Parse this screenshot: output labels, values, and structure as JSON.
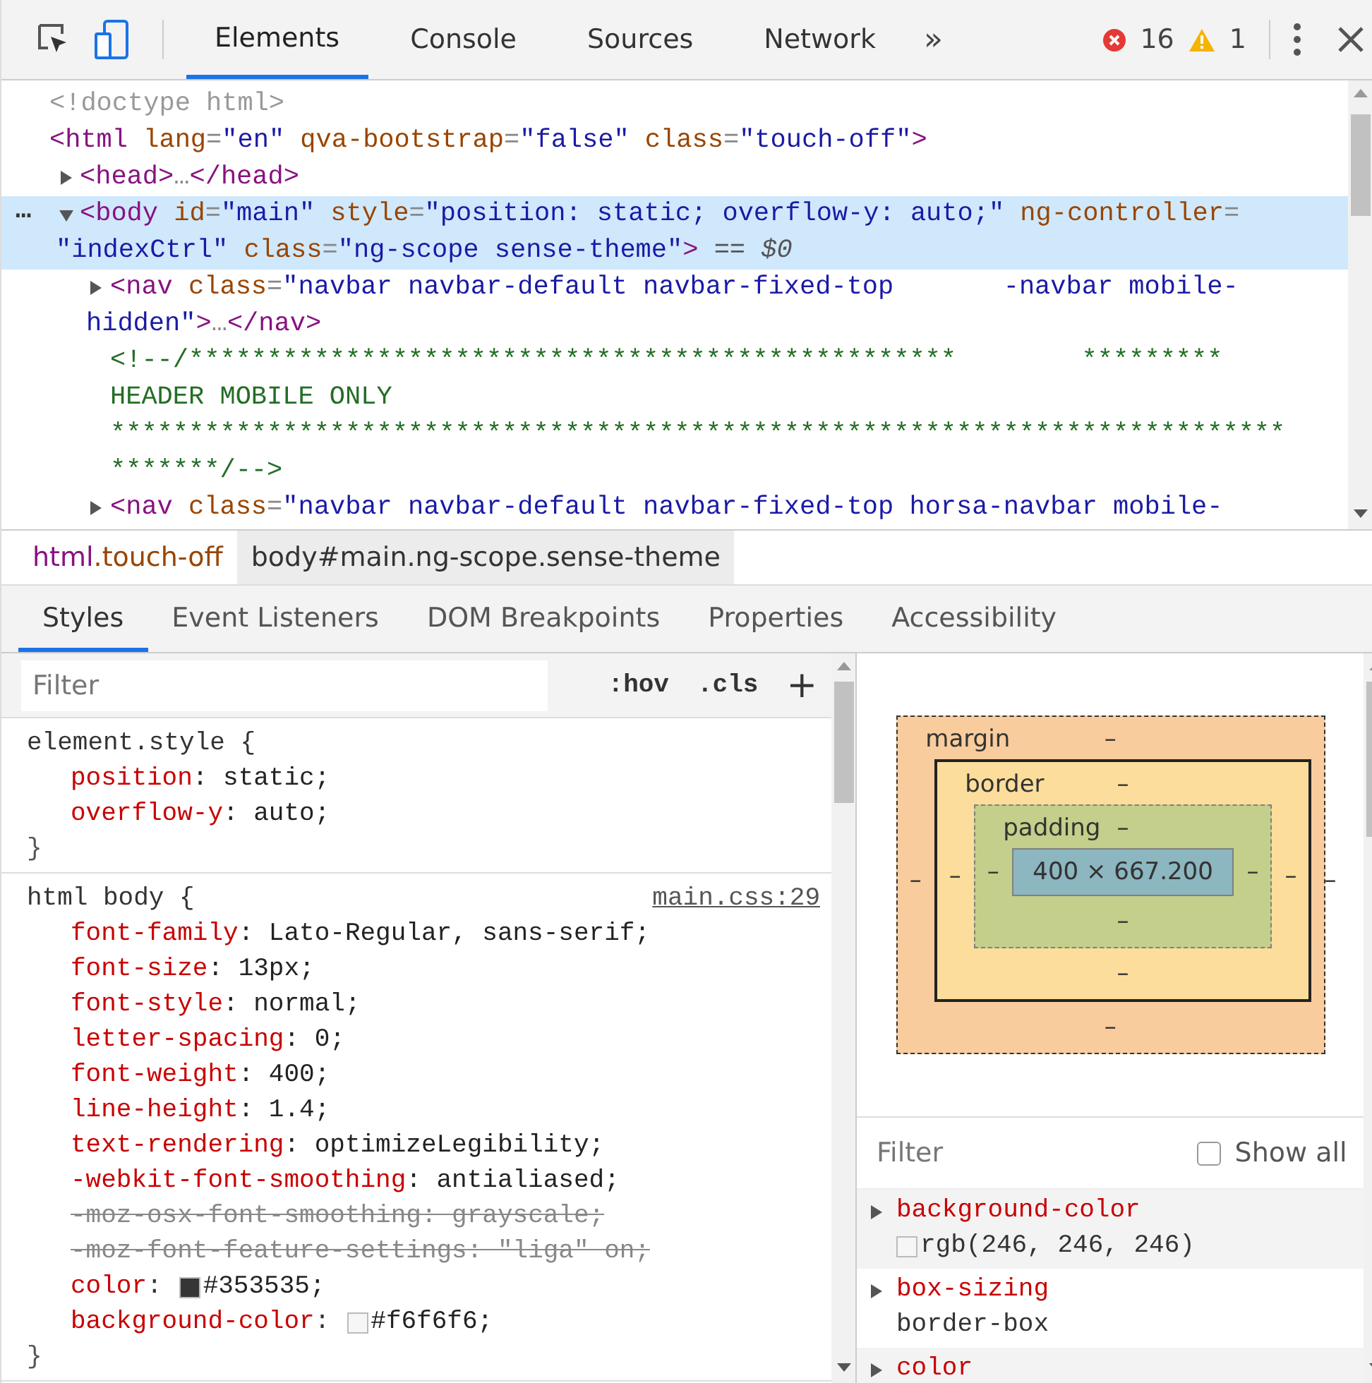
{
  "toolbar": {
    "tabs": [
      {
        "label": "Elements",
        "selected": true
      },
      {
        "label": "Console",
        "selected": false
      },
      {
        "label": "Sources",
        "selected": false
      },
      {
        "label": "Network",
        "selected": false
      }
    ],
    "more": "»",
    "errors": "16",
    "warnings": "1"
  },
  "dom_tree": [
    {
      "selected": false,
      "lines": [
        [
          {
            "kind": "doctype",
            "s": "<!doctype html>"
          }
        ]
      ]
    },
    {
      "selected": false,
      "lines": [
        [
          {
            "kind": "tag",
            "s": "<html"
          },
          {
            "kind": "attr",
            "s": " lang"
          },
          {
            "kind": "punct",
            "s": "="
          },
          {
            "kind": "value",
            "s": "\"en\""
          },
          {
            "kind": "attr",
            "s": " qva-bootstrap"
          },
          {
            "kind": "punct",
            "s": "="
          },
          {
            "kind": "value",
            "s": "\"false\""
          },
          {
            "kind": "attr",
            "s": " class"
          },
          {
            "kind": "punct",
            "s": "="
          },
          {
            "kind": "value",
            "s": "\"touch-off\""
          },
          {
            "kind": "tag",
            "s": ">"
          }
        ]
      ],
      "children": [
        {
          "expanded": false,
          "selected": false,
          "lines": [
            [
              {
                "kind": "tag",
                "s": "<head>"
              },
              {
                "kind": "punct",
                "s": "…"
              },
              {
                "kind": "tag",
                "s": "</head>"
              }
            ]
          ]
        },
        {
          "expanded": true,
          "selected": true,
          "gutter": "…",
          "lines": [
            [
              {
                "kind": "tag",
                "s": "<body"
              },
              {
                "kind": "attr",
                "s": " id"
              },
              {
                "kind": "punct",
                "s": "="
              },
              {
                "kind": "value",
                "s": "\"main\""
              },
              {
                "kind": "attr",
                "s": " style"
              },
              {
                "kind": "punct",
                "s": "="
              },
              {
                "kind": "value",
                "s": "\"position: static; overflow-y: auto;\""
              },
              {
                "kind": "attr",
                "s": " ng-controller"
              },
              {
                "kind": "punct",
                "s": "="
              }
            ],
            [
              {
                "kind": "value",
                "s": "\"indexCtrl\""
              },
              {
                "kind": "attr",
                "s": " class"
              },
              {
                "kind": "punct",
                "s": "="
              },
              {
                "kind": "value",
                "s": "\"ng-scope sense-theme\""
              },
              {
                "kind": "tag",
                "s": ">"
              },
              {
                "kind": "hint",
                "s": " == $0"
              }
            ]
          ],
          "children": [
            {
              "expanded": false,
              "selected": false,
              "lines": [
                [
                  {
                    "kind": "tag",
                    "s": "<nav"
                  },
                  {
                    "kind": "attr",
                    "s": " class"
                  },
                  {
                    "kind": "punct",
                    "s": "="
                  },
                  {
                    "kind": "value",
                    "s": "\"navbar navbar-default navbar-fixed-top       -navbar mobile-"
                  }
                ],
                [
                  {
                    "kind": "value",
                    "s": "hidden\""
                  },
                  {
                    "kind": "tag",
                    "s": ">"
                  },
                  {
                    "kind": "punct",
                    "s": "…"
                  },
                  {
                    "kind": "tag",
                    "s": "</nav>"
                  }
                ]
              ]
            },
            {
              "selected": false,
              "lines": [
                [
                  {
                    "kind": "comment",
                    "s": "<!--/*************************************************        *********"
                  }
                ],
                [
                  {
                    "kind": "comment",
                    "s": "HEADER MOBILE ONLY"
                  }
                ],
                [
                  {
                    "kind": "comment",
                    "s": "***************************************************************************"
                  }
                ],
                [
                  {
                    "kind": "comment",
                    "s": "*******/-->"
                  }
                ]
              ]
            },
            {
              "expanded": false,
              "selected": false,
              "lines": [
                [
                  {
                    "kind": "tag",
                    "s": "<nav"
                  },
                  {
                    "kind": "attr",
                    "s": " class"
                  },
                  {
                    "kind": "punct",
                    "s": "="
                  },
                  {
                    "kind": "value",
                    "s": "\"navbar navbar-default navbar-fixed-top horsa-navbar mobile-"
                  }
                ]
              ]
            }
          ]
        }
      ]
    }
  ],
  "breadcrumbs": [
    {
      "tag": "html",
      "rest": ".touch-off",
      "selected": false
    },
    {
      "tag": "body",
      "rest": "#main.ng-scope.sense-theme",
      "selected": true
    }
  ],
  "sub_tabs": [
    {
      "label": "Styles",
      "selected": true
    },
    {
      "label": "Event Listeners",
      "selected": false
    },
    {
      "label": "DOM Breakpoints",
      "selected": false
    },
    {
      "label": "Properties",
      "selected": false
    },
    {
      "label": "Accessibility",
      "selected": false
    }
  ],
  "styles": {
    "filter": {
      "placeholder": "Filter"
    },
    "hov": ":hov",
    "cls": ".cls",
    "add": "+",
    "rules": [
      {
        "selector": "element.style {",
        "close": "}",
        "props": [
          {
            "name": "position",
            "value": ": static;",
            "overridden": false
          },
          {
            "name": "overflow-y",
            "value": ": auto;",
            "overridden": false
          }
        ]
      },
      {
        "selector": "html body {",
        "source": "main.css:29",
        "close": "}",
        "props": [
          {
            "name": "font-family",
            "value": ": Lato-Regular, sans-serif;",
            "overridden": false
          },
          {
            "name": "font-size",
            "value": ": 13px;",
            "overridden": false
          },
          {
            "name": "font-style",
            "value": ": normal;",
            "overridden": false
          },
          {
            "name": "letter-spacing",
            "value": ": 0;",
            "overridden": false
          },
          {
            "name": "font-weight",
            "value": ": 400;",
            "overridden": false
          },
          {
            "name": "line-height",
            "value": ": 1.4;",
            "overridden": false
          },
          {
            "name": "text-rendering",
            "value": ": optimizeLegibility;",
            "overridden": false
          },
          {
            "name": "-webkit-font-smoothing",
            "value": ": antialiased;",
            "overridden": false
          },
          {
            "name": "-moz-osx-font-smoothing",
            "value": ": grayscale;",
            "overridden": true
          },
          {
            "name": "-moz-font-feature-settings",
            "value": ": \"liga\" on;",
            "overridden": true
          },
          {
            "name": "color",
            "sep": ":",
            "value": "#353535;",
            "overridden": false,
            "color": "#353535"
          },
          {
            "name": "background-color",
            "sep": ":",
            "value": "#f6f6f6;",
            "overridden": false,
            "color": "#f6f6f6"
          }
        ]
      }
    ]
  },
  "box_model": {
    "margin": {
      "label": "margin",
      "top": "–",
      "right": "–",
      "bottom": "–",
      "left": "–"
    },
    "border": {
      "label": "border",
      "top": "–",
      "right": "–",
      "bottom": "–",
      "left": "–"
    },
    "padding": {
      "label": "padding",
      "top": "–",
      "right": "–",
      "bottom": "–",
      "left": "–"
    },
    "content": "400 × 667.200"
  },
  "computed": {
    "filter": {
      "placeholder": "Filter"
    },
    "show_all": {
      "label": "Show all",
      "checked": false
    },
    "items": [
      {
        "name": "background-color",
        "value": "rgb(246, 246, 246)",
        "color": "#f6f6f6"
      },
      {
        "name": "box-sizing",
        "value": "border-box"
      },
      {
        "name": "color"
      }
    ]
  }
}
